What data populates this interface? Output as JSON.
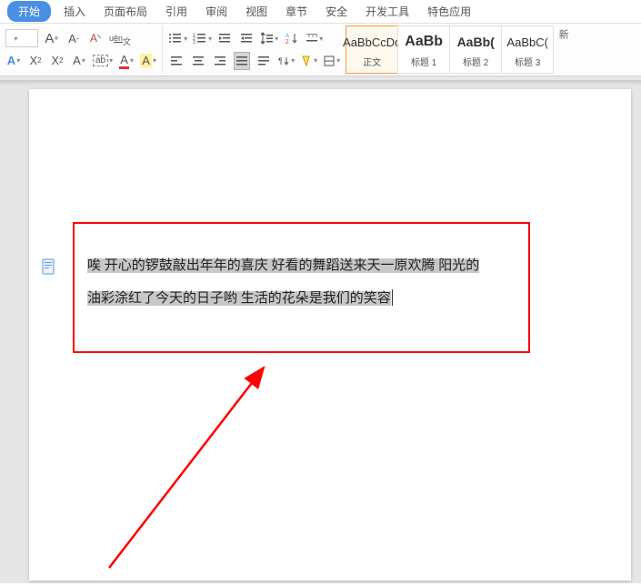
{
  "menu": {
    "tabs": [
      "开始",
      "插入",
      "页面布局",
      "引用",
      "审阅",
      "视图",
      "章节",
      "安全",
      "开发工具",
      "特色应用"
    ]
  },
  "ribbon": {
    "font": {
      "grow": "A⁺",
      "shrink": "A⁻",
      "clear": "A",
      "phonetic": "wén",
      "bold": "A",
      "sub": "X₂",
      "sup": "X²",
      "caseA": "A",
      "box": "ab",
      "colorA": "A",
      "highlightA": "A"
    },
    "styles": [
      {
        "preview": "AaBbCcDd",
        "label": "正文",
        "cls": "",
        "selected": true
      },
      {
        "preview": "AaBb",
        "label": "标题 1",
        "cls": "h1",
        "selected": false
      },
      {
        "preview": "AaBb(",
        "label": "标题 2",
        "cls": "h2",
        "selected": false
      },
      {
        "preview": "AaBbC(",
        "label": "标题 3",
        "cls": "h3",
        "selected": false
      }
    ],
    "more": "新"
  },
  "doc": {
    "line1a": "唉 开心的锣鼓敲出年年的喜庆 好看的舞蹈送来天一原欢腾 阳光的",
    "line2a": "油彩涂红了今天的日子哟  生活的花朵是我们的笑容"
  }
}
